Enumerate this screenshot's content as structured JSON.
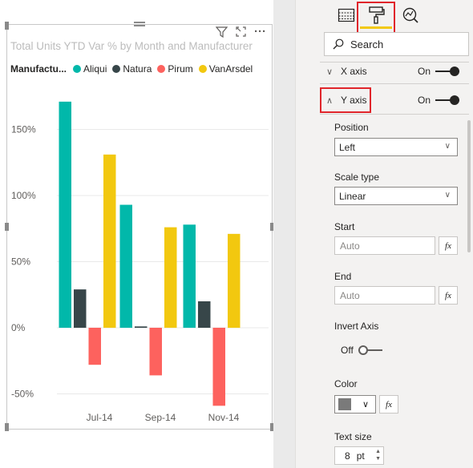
{
  "visual": {
    "title": "Total Units YTD Var % by Month and Manufacturer",
    "icons": [
      "filter-icon",
      "focus-mode-icon",
      "more-options-icon"
    ],
    "more_label": "···"
  },
  "legend": {
    "title": "Manufactu...",
    "items": [
      {
        "label": "Aliqui",
        "color": "#01b8aa"
      },
      {
        "label": "Natura",
        "color": "#374649"
      },
      {
        "label": "Pirum",
        "color": "#fd625e"
      },
      {
        "label": "VanArsdel",
        "color": "#f2c80f"
      }
    ]
  },
  "chart_data": {
    "type": "bar",
    "title": "Total Units YTD Var % by Month and Manufacturer",
    "categories": [
      "Jul-14",
      "Sep-14",
      "Nov-14"
    ],
    "series": [
      {
        "name": "Aliqui",
        "color": "#01b8aa",
        "values": [
          171,
          93,
          78
        ]
      },
      {
        "name": "Natura",
        "color": "#374649",
        "values": [
          29,
          1,
          20
        ]
      },
      {
        "name": "Pirum",
        "color": "#fd625e",
        "values": [
          -28,
          -36,
          -59
        ]
      },
      {
        "name": "VanArsdel",
        "color": "#f2c80f",
        "values": [
          131,
          76,
          71
        ]
      }
    ],
    "yticks": [
      150,
      100,
      50,
      0,
      -50
    ],
    "ytick_labels": [
      "150%",
      "100%",
      "50%",
      "0%",
      "-50%"
    ],
    "ylim": [
      -65,
      190
    ],
    "grid": true,
    "legend_position": "top-left"
  },
  "pane": {
    "tabs": [
      {
        "name": "fields-tab",
        "icon": "table-grid-icon"
      },
      {
        "name": "format-tab",
        "icon": "paint-roller-icon",
        "active": true
      },
      {
        "name": "analytics-tab",
        "icon": "analytics-magnifier-icon"
      }
    ],
    "search_placeholder": "Search",
    "x_axis": {
      "label": "X axis",
      "toggle": "On"
    },
    "y_axis": {
      "label": "Y axis",
      "toggle": "On"
    },
    "position": {
      "label": "Position",
      "value": "Left"
    },
    "scale_type": {
      "label": "Scale type",
      "value": "Linear"
    },
    "start": {
      "label": "Start",
      "placeholder": "Auto"
    },
    "end": {
      "label": "End",
      "placeholder": "Auto"
    },
    "fx_label": "fx",
    "invert_axis": {
      "label": "Invert Axis",
      "toggle": "Off"
    },
    "color": {
      "label": "Color",
      "value": "#7a7a7a"
    },
    "text_size": {
      "label": "Text size",
      "value": "8",
      "unit": "pt"
    },
    "highlight_color": "#e0252b",
    "accent_color": "#f2c811"
  }
}
